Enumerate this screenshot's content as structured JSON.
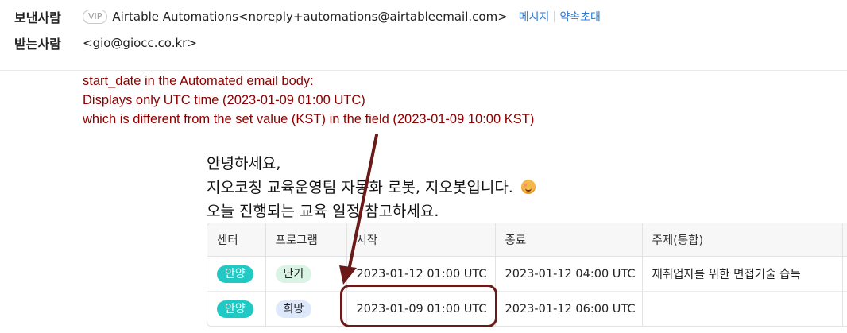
{
  "header": {
    "from_label": "보낸사람",
    "vip_badge": "VIP",
    "sender": "Airtable Automations<noreply+automations@airtableemail.com>",
    "message_link": "메시지",
    "invite_link": "약속초대",
    "to_label": "받는사람",
    "recipient": "<gio@giocc.co.kr>"
  },
  "annotation": {
    "line1": "start_date in the Automated email body:",
    "line2": "Displays only UTC time (2023-01-09 01:00 UTC)",
    "line3": "which is different from the set value (KST) in the field (2023-01-09 10:00 KST)",
    "color": "#8b0000"
  },
  "body": {
    "line1": "안녕하세요,",
    "line2": "지오코칭 교육운영팀 자동화 로봇, 지오봇입니다.",
    "line3": "오늘 진행되는 교육 일정 참고하세요.",
    "emoji": "smiling-face-emoji"
  },
  "table": {
    "headers": [
      "센터",
      "프로그램",
      "시작",
      "종료",
      "주제(통합)"
    ],
    "rows": [
      {
        "center": "안양",
        "program": "단기",
        "program_color": "#d9f3e4",
        "start": "2023-01-12 01:00 UTC",
        "end": "2023-01-12 04:00 UTC",
        "topic": "재취업자를 위한 면접기술 습득"
      },
      {
        "center": "안양",
        "program": "희망",
        "program_color": "#dde8fb",
        "start": "2023-01-09 01:00 UTC",
        "end": "2023-01-12 06:00 UTC",
        "topic": ""
      }
    ]
  },
  "colors": {
    "link": "#2b7bd6",
    "center_pill": "#20c9c4",
    "callout": "#6b1a1a"
  }
}
